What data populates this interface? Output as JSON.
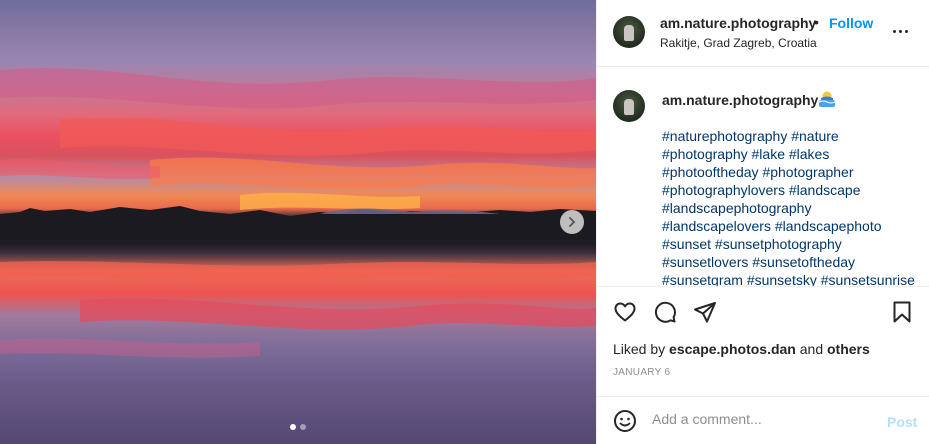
{
  "media": {
    "next_icon": "chevron-right-icon",
    "slides_total": 2,
    "active_slide": 1
  },
  "author": {
    "username": "am.nature.photography",
    "location": "Rakitje, Grad Zagreb, Croatia",
    "follow_label": "Follow",
    "separator": "•"
  },
  "caption": {
    "username": "am.nature.photography",
    "emoji": "person-in-lake-emoji",
    "tag_lines": [
      "#naturephotography #nature",
      "#photography #lake #lakes",
      "#photooftheday #photographer",
      "#photographylovers #landscape",
      "#landscapephotography",
      "#landscapelovers #landscapephoto",
      "#sunset #sunsetphotography",
      "#sunsetlovers #sunsetoftheday",
      "#sunsetgram #sunsetsky #sunsetsunrise"
    ]
  },
  "actions": {
    "like_icon": "heart-icon",
    "comment_icon": "comment-icon",
    "share_icon": "send-icon",
    "save_icon": "bookmark-icon"
  },
  "likes": {
    "prefix": "Liked by",
    "user": "escape.photos.dan",
    "middle": "and",
    "others": "others"
  },
  "date": "January 6",
  "comment": {
    "placeholder": "Add a comment...",
    "post_label": "Post",
    "emoji_icon": "smiley-icon"
  },
  "colors": {
    "accent": "#0095f6",
    "post_disabled": "#b2dffc",
    "text": "#262626",
    "muted": "#8e8e8e",
    "hashtag": "#00376b"
  }
}
